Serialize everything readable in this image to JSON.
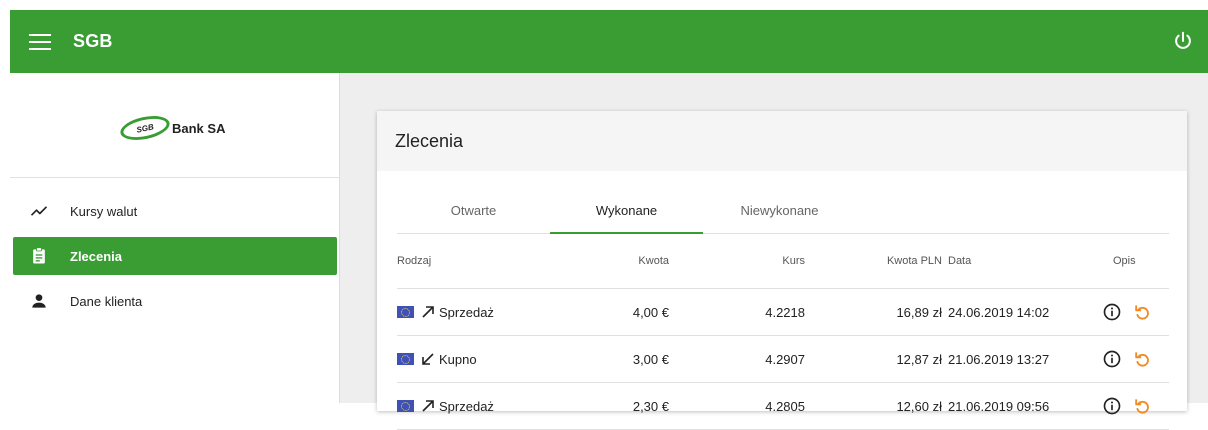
{
  "app": {
    "title": "SGB"
  },
  "logo": {
    "mark": "SGB",
    "text": "Bank SA"
  },
  "sidebar": {
    "items": [
      {
        "label": "Kursy walut",
        "icon": "trending-icon",
        "active": false
      },
      {
        "label": "Zlecenia",
        "icon": "clipboard-icon",
        "active": true
      },
      {
        "label": "Dane klienta",
        "icon": "person-icon",
        "active": false
      }
    ]
  },
  "card": {
    "title": "Zlecenia"
  },
  "tabs": [
    {
      "label": "Otwarte",
      "active": false
    },
    {
      "label": "Wykonane",
      "active": true
    },
    {
      "label": "Niewykonane",
      "active": false
    }
  ],
  "table": {
    "headers": {
      "rodzaj": "Rodzaj",
      "kwota": "Kwota",
      "kurs": "Kurs",
      "kwota_pln": "Kwota PLN",
      "data": "Data",
      "opis": "Opis"
    },
    "rows": [
      {
        "type": "Sprzedaż",
        "direction": "up",
        "kwota": "4,00 €",
        "kurs": "4.2218",
        "kwota_pln": "16,89 zł",
        "data": "24.06.2019 14:02"
      },
      {
        "type": "Kupno",
        "direction": "down",
        "kwota": "3,00 €",
        "kurs": "4.2907",
        "kwota_pln": "12,87 zł",
        "data": "21.06.2019 13:27"
      },
      {
        "type": "Sprzedaż",
        "direction": "up",
        "kwota": "2,30 €",
        "kurs": "4.2805",
        "kwota_pln": "12,60 zł",
        "data": "21.06.2019 09:56"
      }
    ]
  },
  "colors": {
    "brand": "#3a9d34",
    "undo": "#f08a24",
    "flag": "#3f51b5"
  }
}
